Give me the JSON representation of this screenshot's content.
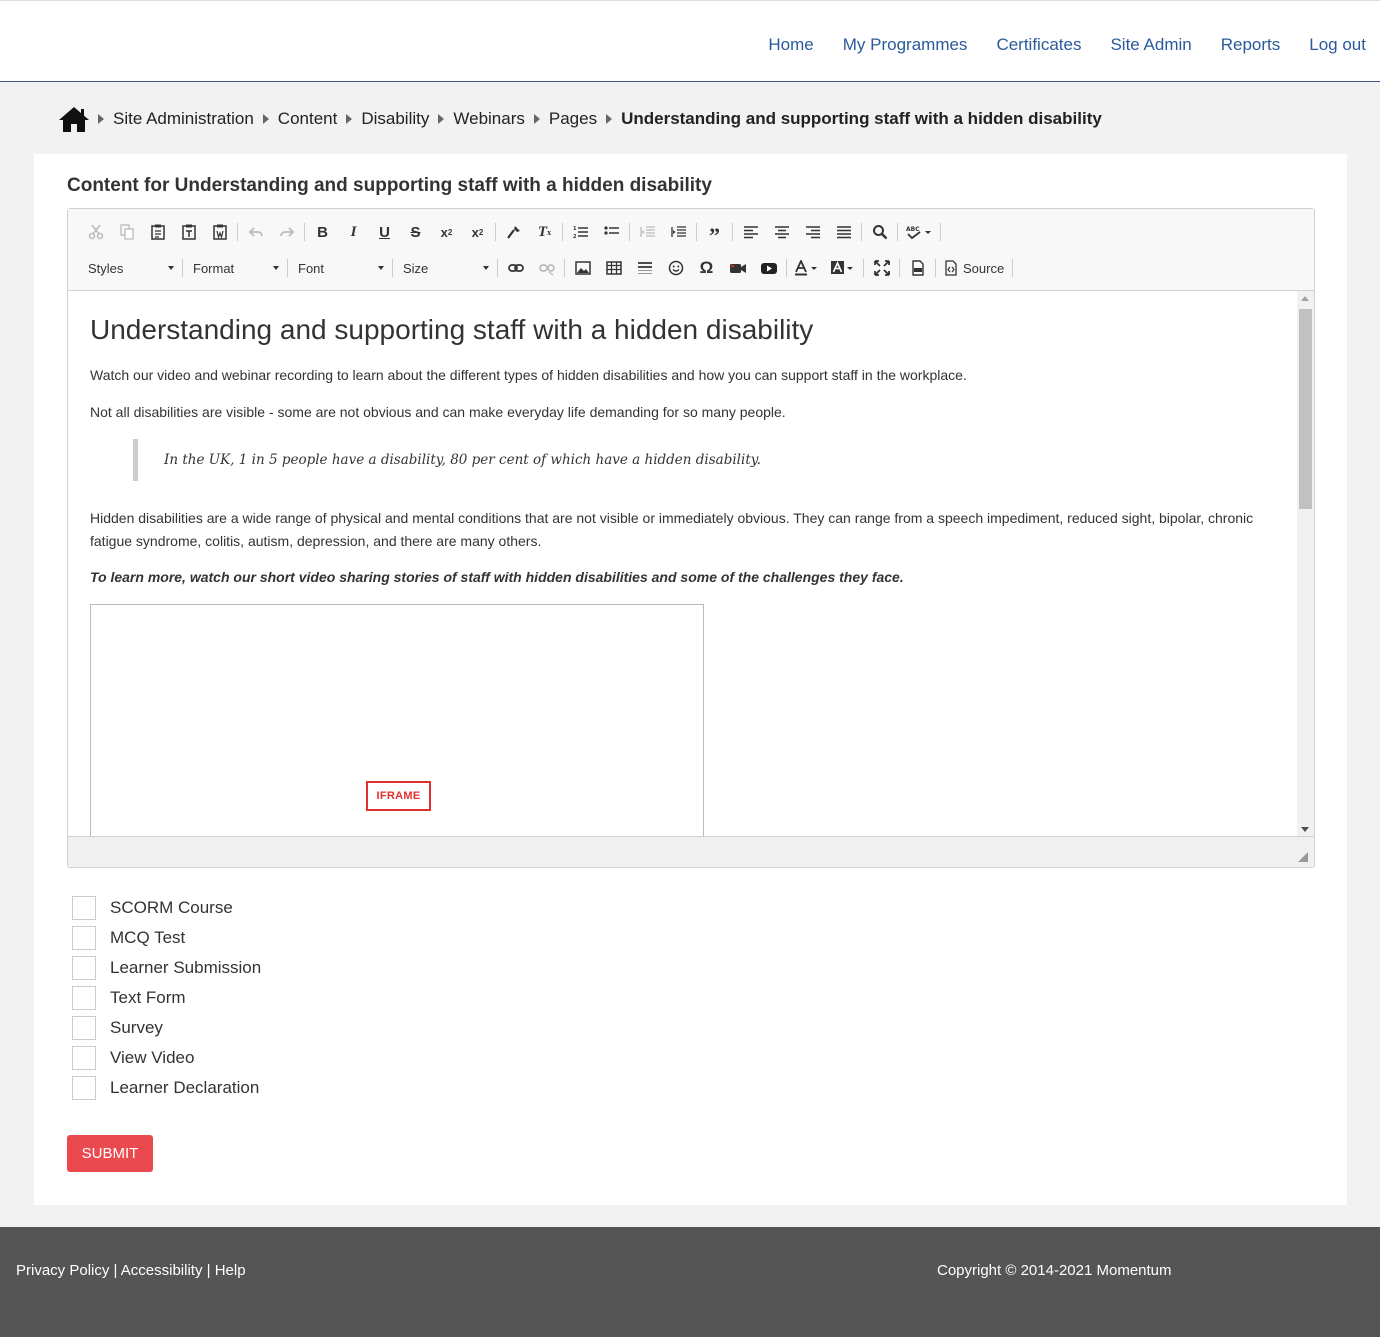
{
  "nav": {
    "items": [
      {
        "label": "Home"
      },
      {
        "label": "My Programmes"
      },
      {
        "label": "Certificates"
      },
      {
        "label": "Site Admin"
      },
      {
        "label": "Reports"
      },
      {
        "label": "Log out"
      }
    ]
  },
  "breadcrumb": {
    "icon": "home-icon",
    "items": [
      "Site Administration",
      "Content",
      "Disability",
      "Webinars",
      "Pages"
    ],
    "current": "Understanding and supporting staff with a hidden disability"
  },
  "panel": {
    "title": "Content for Understanding and supporting staff with a hidden disability"
  },
  "editor": {
    "combos": {
      "styles": "Styles",
      "format": "Format",
      "font": "Font",
      "size": "Size"
    },
    "source_label": "Source",
    "document": {
      "heading": "Understanding and supporting staff with a hidden disability",
      "p1": "Watch our video and webinar recording to learn about the different types of hidden disabilities and how you can support staff in the workplace.",
      "p2": "Not all disabilities are visible - some are not obvious and can make everyday life demanding for so many people.",
      "quote": "In the UK, 1 in 5 people have a disability, 80 per cent of which have a hidden disability.",
      "p3": "Hidden disabilities are a wide range of physical and mental conditions that are not visible or immediately obvious. They can range from a speech impediment, reduced sight, bipolar, chronic fatigue syndrome, colitis, autism, depression, and there are many others.",
      "p4": "To learn more, watch our short video sharing stories of staff with hidden disabilities and some of the challenges they face.",
      "iframe_label": "IFRAME"
    }
  },
  "options": [
    {
      "label": "SCORM Course",
      "checked": false
    },
    {
      "label": "MCQ Test",
      "checked": false
    },
    {
      "label": "Learner Submission",
      "checked": false
    },
    {
      "label": "Text Form",
      "checked": false
    },
    {
      "label": "Survey",
      "checked": false
    },
    {
      "label": "View Video",
      "checked": false
    },
    {
      "label": "Learner Declaration",
      "checked": false
    }
  ],
  "submit_label": "SUBMIT",
  "footer": {
    "privacy": "Privacy Policy",
    "accessibility": "Accessibility",
    "help": "Help",
    "separator": " | ",
    "copyright": "Copyright © 2014-2021 Momentum"
  },
  "colors": {
    "nav_link": "#2a5a9c",
    "submit_bg": "#ea4a4f",
    "footer_bg": "#555555",
    "iframe_tag": "#e03030"
  }
}
